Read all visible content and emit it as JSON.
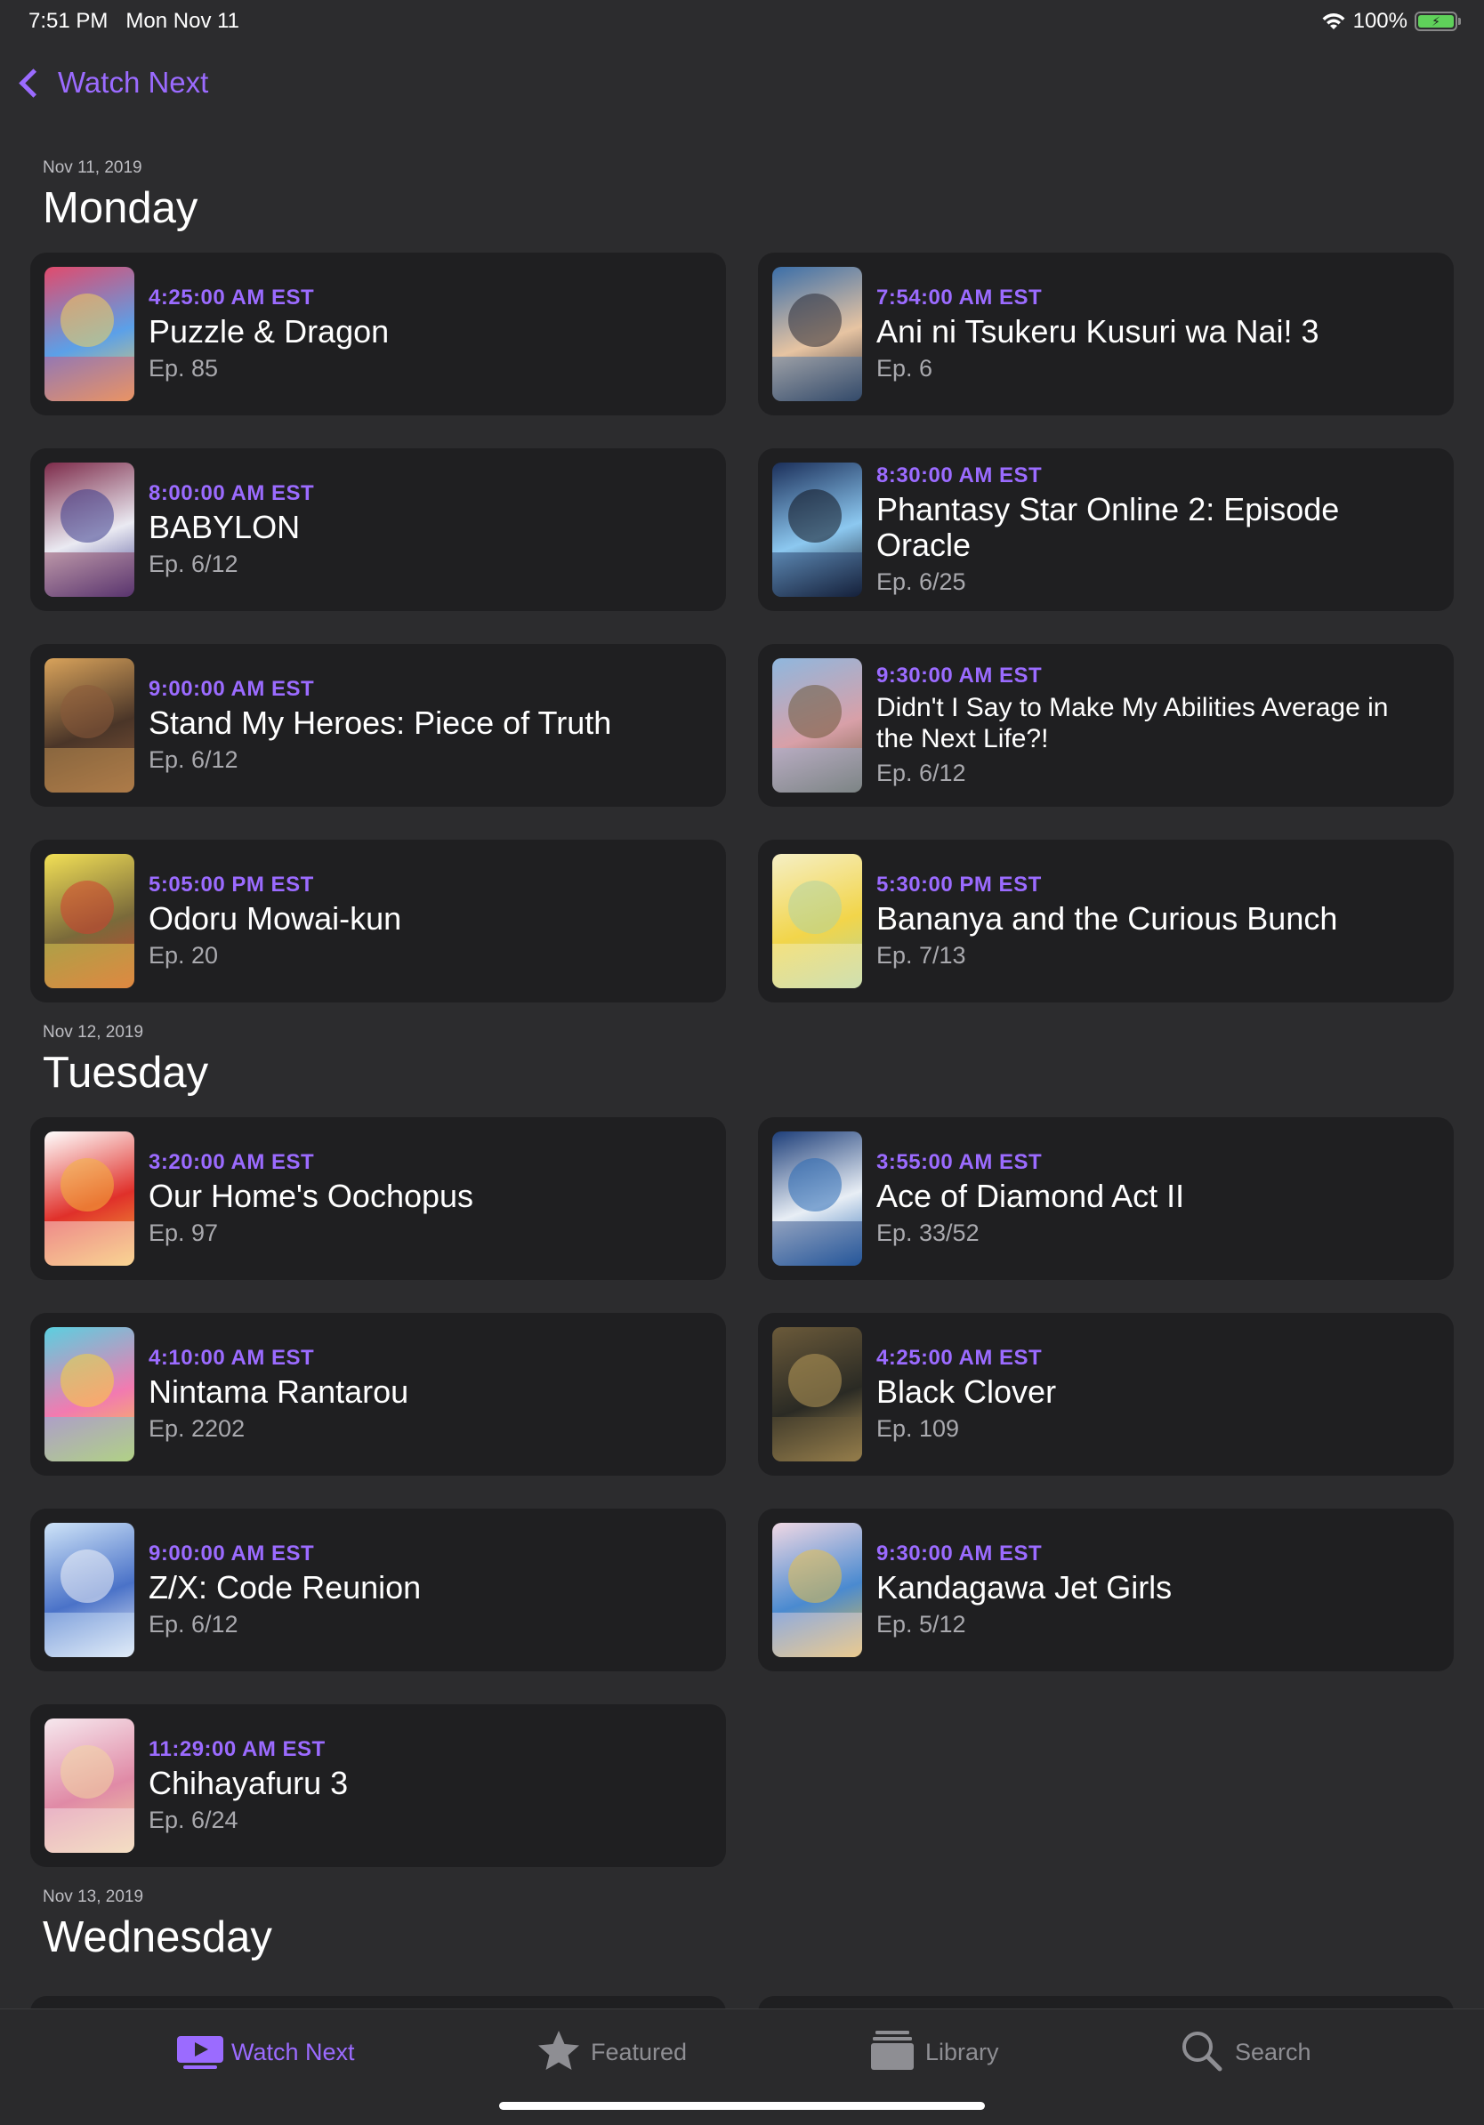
{
  "status_bar": {
    "time": "7:51 PM",
    "date": "Mon Nov 11",
    "battery": "100%"
  },
  "nav": {
    "back_label": "Watch Next"
  },
  "days": [
    {
      "date": "Nov 11, 2019",
      "name": "Monday",
      "items": [
        {
          "time": "4:25:00 AM EST",
          "title": "Puzzle & Dragon",
          "ep": "Ep. 85",
          "colors": [
            "#e14a6c",
            "#5ba0e8",
            "#f2d15d"
          ]
        },
        {
          "time": "7:54:00 AM EST",
          "title": "Ani ni Tsukeru Kusuri wa Nai! 3",
          "ep": "Ep. 6",
          "colors": [
            "#3b6ea8",
            "#e7c4a2",
            "#2b2b36"
          ]
        },
        {
          "time": "8:00:00 AM EST",
          "title": "BABYLON",
          "ep": "Ep. 6/12",
          "colors": [
            "#7d2b4a",
            "#eaeaf2",
            "#3c3c8c"
          ]
        },
        {
          "time": "8:30:00 AM EST",
          "title": "Phantasy Star Online 2: Episode Oracle",
          "ep": "Ep. 6/25",
          "colors": [
            "#1b2f5a",
            "#8cc8f0",
            "#10141f"
          ]
        },
        {
          "time": "9:00:00 AM EST",
          "title": "Stand My Heroes: Piece of Truth",
          "ep": "Ep. 6/12",
          "colors": [
            "#d9a35b",
            "#4a3528",
            "#8a5a3a"
          ]
        },
        {
          "time": "9:30:00 AM EST",
          "title": "Didn't I Say to Make My Abilities Average in the Next Life?!",
          "ep": "Ep. 6/12",
          "colors": [
            "#8fb7de",
            "#d8a0a8",
            "#6e5a3c"
          ]
        },
        {
          "time": "5:05:00 PM EST",
          "title": "Odoru Mowai-kun",
          "ep": "Ep. 20",
          "colors": [
            "#f2e056",
            "#7a6a3a",
            "#d04030"
          ]
        },
        {
          "time": "5:30:00 PM EST",
          "title": "Bananya and the Curious Bunch",
          "ep": "Ep. 7/13",
          "colors": [
            "#f5efc5",
            "#f2d54a",
            "#b0d4a0"
          ]
        }
      ]
    },
    {
      "date": "Nov 12, 2019",
      "name": "Tuesday",
      "items": [
        {
          "time": "3:20:00 AM EST",
          "title": "Our Home's Oochopus",
          "ep": "Ep. 97",
          "colors": [
            "#ffffff",
            "#e0302a",
            "#f4b23a"
          ]
        },
        {
          "time": "3:55:00 AM EST",
          "title": "Ace of Diamond Act II",
          "ep": "Ep. 33/52",
          "colors": [
            "#1e3f7a",
            "#e8eef5",
            "#2a6ab4"
          ]
        },
        {
          "time": "4:10:00 AM EST",
          "title": "Nintama Rantarou",
          "ep": "Ep. 2202",
          "colors": [
            "#5ad0e0",
            "#f27ab0",
            "#f7d23c"
          ]
        },
        {
          "time": "4:25:00 AM EST",
          "title": "Black Clover",
          "ep": "Ep. 109",
          "colors": [
            "#6b5a3a",
            "#2a2a24",
            "#b89a5a"
          ]
        },
        {
          "time": "9:00:00 AM EST",
          "title": "Z/X: Code Reunion",
          "ep": "Ep. 6/12",
          "colors": [
            "#cfe4f8",
            "#4a72c8",
            "#f0f2f8"
          ]
        },
        {
          "time": "9:30:00 AM EST",
          "title": "Kandagawa Jet Girls",
          "ep": "Ep. 5/12",
          "colors": [
            "#f0d8e4",
            "#4a8ad0",
            "#e6c04a"
          ]
        },
        {
          "time": "11:29:00 AM EST",
          "title": "Chihayafuru 3",
          "ep": "Ep. 6/24",
          "colors": [
            "#f6e8ee",
            "#e08aa6",
            "#f2d6a0"
          ]
        }
      ]
    },
    {
      "date": "Nov 13, 2019",
      "name": "Wednesday",
      "items": []
    }
  ],
  "tabs": [
    {
      "label": "Watch Next",
      "icon": "play-tv-icon",
      "active": true
    },
    {
      "label": "Featured",
      "icon": "star-icon",
      "active": false
    },
    {
      "label": "Library",
      "icon": "stack-icon",
      "active": false
    },
    {
      "label": "Search",
      "icon": "magnifier-icon",
      "active": false
    }
  ],
  "colors": {
    "accent": "#9b6bff",
    "background": "#2c2c2e",
    "card": "#1f1f21"
  }
}
